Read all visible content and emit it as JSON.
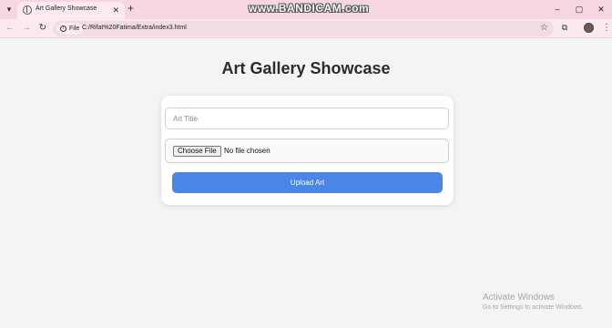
{
  "browser": {
    "tab_title": "Art Gallery Showcase",
    "new_tab_symbol": "+",
    "tab_menu_symbol": "▾",
    "tab_close_symbol": "✕",
    "recorder_watermark": "www.BANDICAM.com",
    "window_controls": {
      "minimize": "–",
      "maximize": "▢",
      "close": "✕"
    },
    "site_label": "File",
    "url": "C:/Rifat%20Fatima/Extra/index3.html",
    "icons": {
      "back": "arrow-left-icon",
      "forward": "arrow-right-icon",
      "reload": "reload-icon",
      "site_info": "info-icon",
      "bookmark": "star-icon",
      "extensions": "puzzle-icon",
      "profile": "avatar",
      "menu": "kebab-icon"
    }
  },
  "page": {
    "title": "Art Gallery Showcase",
    "form": {
      "title_placeholder": "Art Title",
      "choose_file_label": "Choose File",
      "file_status": "No file chosen",
      "upload_label": "Upload Art"
    },
    "colors": {
      "accent": "#4a86e8",
      "background": "#f3f4f6",
      "title": "#2b2b2b"
    }
  },
  "os_overlay": {
    "activate_title": "Activate Windows",
    "activate_subtitle": "Go to Settings to activate Windows."
  }
}
